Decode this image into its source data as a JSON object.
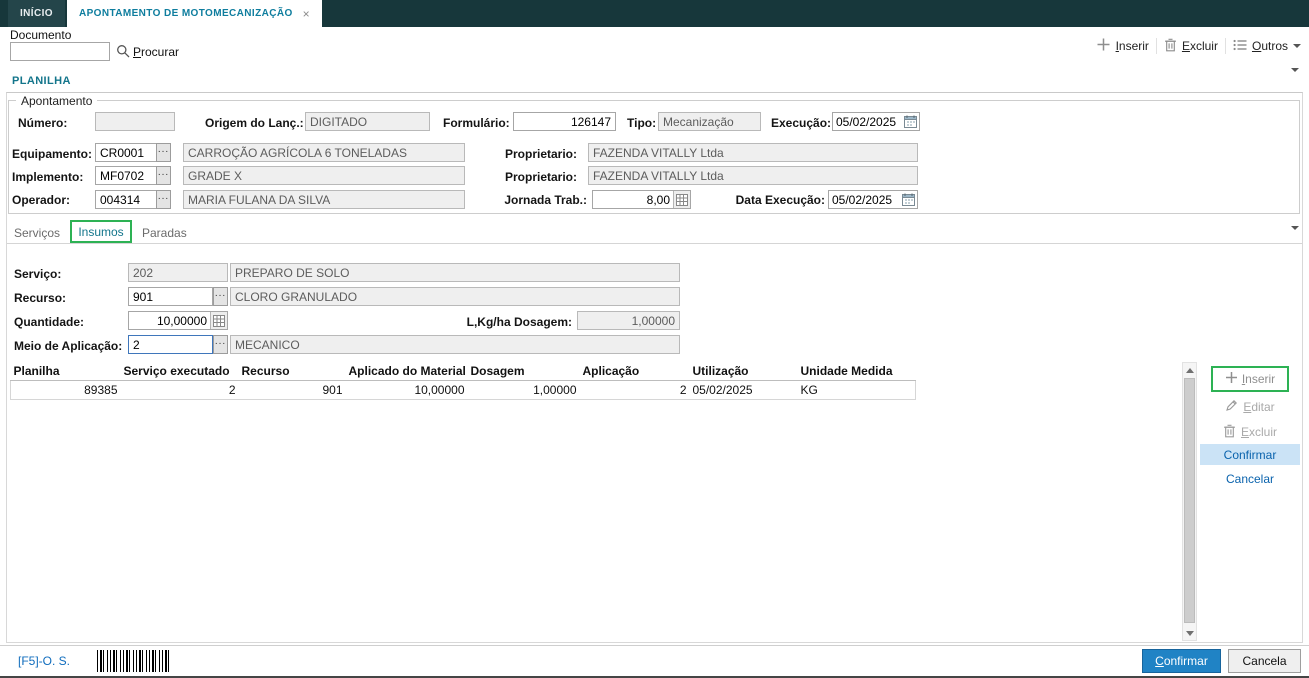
{
  "colors": {
    "topbar": "#17373b",
    "accent_teal": "#0e7d9e",
    "accent_green": "#2db254",
    "accent_blue": "#0a63ad",
    "confirm_button_bg": "#2083c5"
  },
  "window": {
    "tabs": [
      {
        "label": "INÍCIO"
      },
      {
        "label": "APONTAMENTO DE MOTOMECANIZAÇÃO",
        "close_glyph": "×"
      }
    ]
  },
  "toolbar": {
    "document_label": "Documento",
    "document_value": "",
    "search_label": "Procurar",
    "insert_label": "Inserir",
    "delete_label": "Excluir",
    "others_label": "Outros"
  },
  "planilha_tab": "PLANILHA",
  "apontamento": {
    "legend": "Apontamento",
    "numero_label": "Número:",
    "numero_value": "",
    "origem_label": "Origem do Lanç.:",
    "origem_value": "DIGITADO",
    "formulario_label": "Formulário:",
    "formulario_value": "126147",
    "tipo_label": "Tipo:",
    "tipo_value": "Mecanização",
    "execucao_label": "Execução:",
    "execucao_value": "05/02/2025",
    "equipamento_label": "Equipamento:",
    "equipamento_code": "CR0001",
    "equipamento_desc": "CARROÇÃO AGRÍCOLA 6 TONELADAS",
    "proprietario_equip_label": "Proprietario:",
    "proprietario_equip_value": "FAZENDA VITALLY Ltda",
    "implemento_label": "Implemento:",
    "implemento_code": "MF0702",
    "implemento_desc": "GRADE X",
    "proprietario_impl_label": "Proprietario:",
    "proprietario_impl_value": "FAZENDA VITALLY Ltda",
    "operador_label": "Operador:",
    "operador_code": "004314",
    "operador_desc": "MARIA FULANA DA SILVA",
    "jornada_label": "Jornada Trab.:",
    "jornada_value": "8,00",
    "data_execucao_label": "Data Execução:",
    "data_execucao_value": "05/02/2025"
  },
  "detail_tabs": {
    "servicos": "Serviços",
    "insumos": "Insumos",
    "paradas": "Paradas"
  },
  "insumos_form": {
    "servico_label": "Serviço:",
    "servico_code": "202",
    "servico_desc": "PREPARO DE SOLO",
    "recurso_label": "Recurso:",
    "recurso_code": "901",
    "recurso_desc": "CLORO GRANULADO",
    "quantidade_label": "Quantidade:",
    "quantidade_value": "10,00000",
    "dosagem_label": "L,Kg/ha Dosagem:",
    "dosagem_value": "1,00000",
    "meio_label": "Meio de Aplicação:",
    "meio_code": "2",
    "meio_desc": "MECANICO"
  },
  "grid": {
    "headers": [
      "Planilha",
      "Serviço executado",
      "Recurso",
      "Aplicado do Material",
      "Dosagem",
      "Aplicação",
      "Utilização",
      "Unidade Medida"
    ],
    "rows": [
      [
        "89385",
        "2",
        "901",
        "10,00000",
        "1,00000",
        "2",
        "05/02/2025",
        "KG"
      ]
    ]
  },
  "side_actions": {
    "inserir": "Inserir",
    "editar": "Editar",
    "excluir": "Excluir",
    "confirmar": "Confirmar",
    "cancelar": "Cancelar"
  },
  "footer": {
    "os_shortcut": "[F5]-O. S.",
    "confirm": "Confirmar",
    "cancel": "Cancela"
  }
}
